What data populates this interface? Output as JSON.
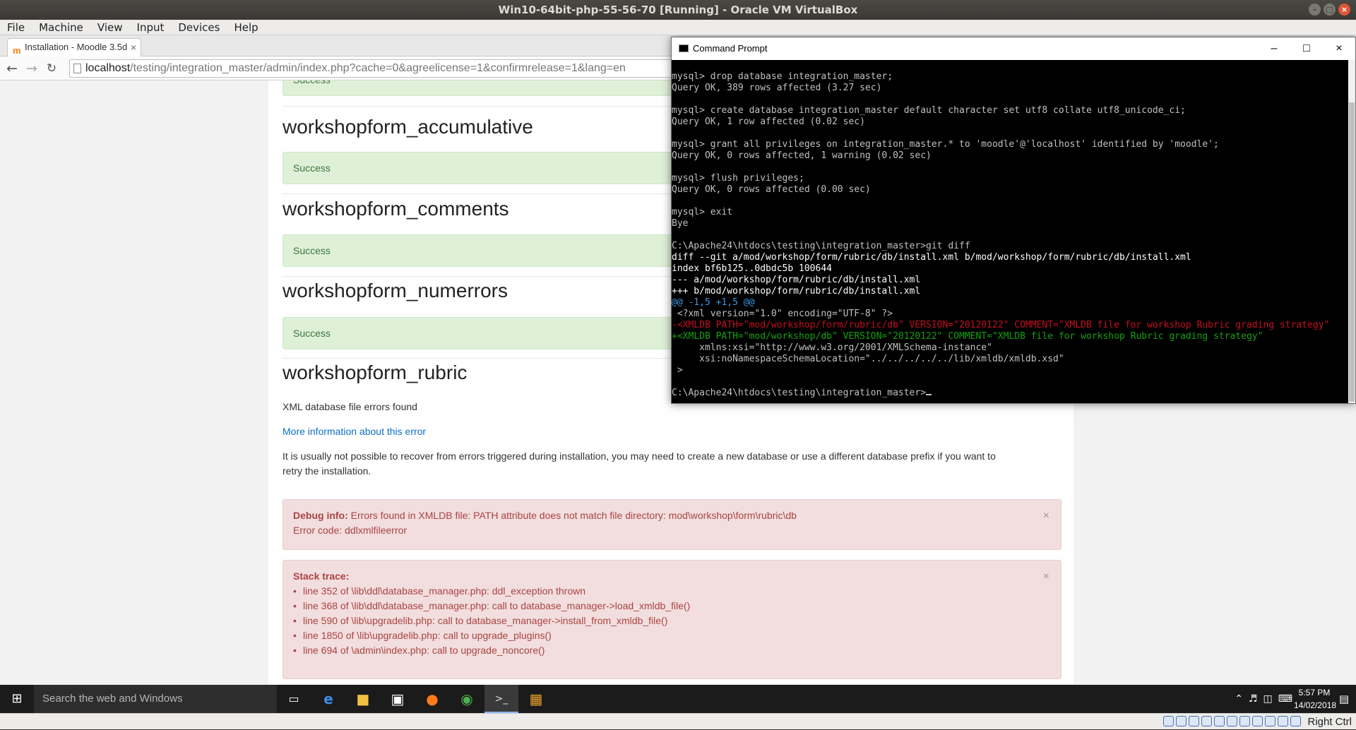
{
  "host": {
    "window_title": "Win10-64bit-php-55-56-70 [Running] - Oracle VM VirtualBox",
    "menu": [
      "File",
      "Machine",
      "View",
      "Input",
      "Devices",
      "Help"
    ],
    "host_key": "Right Ctrl"
  },
  "browser": {
    "tab_title": "Installation - Moodle 3.5d",
    "url_host": "localhost",
    "url_path": "/testing/integration_master/admin/index.php?cache=0&agreelicense=1&confirmrelease=1&lang=en"
  },
  "moodle": {
    "top_success": "Success",
    "sections": [
      {
        "title": "workshopform_accumulative",
        "status": "Success"
      },
      {
        "title": "workshopform_comments",
        "status": "Success"
      },
      {
        "title": "workshopform_numerrors",
        "status": "Success"
      }
    ],
    "error_section_title": "workshopform_rubric",
    "error_summary": "XML database file errors found",
    "more_info_link": "More information about this error",
    "recover_text_1": "It is usually not possible to recover from errors triggered during installation, you may need to create a new database or use a different database prefix if you want to",
    "recover_text_2": "retry the installation.",
    "debug_label": "Debug info:",
    "debug_message": "Errors found in XMLDB file: PATH attribute does not match file directory: mod\\workshop\\form\\rubric\\db",
    "error_code": "Error code: ddlxmlfileerror",
    "stack_label": "Stack trace:",
    "stack_trace": [
      "line 352 of \\lib\\ddl\\database_manager.php: ddl_exception thrown",
      "line 368 of \\lib\\ddl\\database_manager.php: call to database_manager->load_xmldb_file()",
      "line 590 of \\lib\\upgradelib.php: call to database_manager->install_from_xmldb_file()",
      "line 1850 of \\lib\\upgradelib.php: call to upgrade_plugins()",
      "line 694 of \\admin\\index.php: call to upgrade_noncore()"
    ]
  },
  "cmd": {
    "title": "Command Prompt",
    "lines": [
      {
        "t": "mysql> drop database integration_master;",
        "c": ""
      },
      {
        "t": "Query OK, 389 rows affected (3.27 sec)",
        "c": ""
      },
      {
        "t": "",
        "c": ""
      },
      {
        "t": "mysql> create database integration_master default character set utf8 collate utf8_unicode_ci;",
        "c": ""
      },
      {
        "t": "Query OK, 1 row affected (0.02 sec)",
        "c": ""
      },
      {
        "t": "",
        "c": ""
      },
      {
        "t": "mysql> grant all privileges on integration_master.* to 'moodle'@'localhost' identified by 'moodle';",
        "c": ""
      },
      {
        "t": "Query OK, 0 rows affected, 1 warning (0.02 sec)",
        "c": ""
      },
      {
        "t": "",
        "c": ""
      },
      {
        "t": "mysql> flush privileges;",
        "c": ""
      },
      {
        "t": "Query OK, 0 rows affected (0.00 sec)",
        "c": ""
      },
      {
        "t": "",
        "c": ""
      },
      {
        "t": "mysql> exit",
        "c": ""
      },
      {
        "t": "Bye",
        "c": ""
      },
      {
        "t": "",
        "c": ""
      },
      {
        "t": "C:\\Apache24\\htdocs\\testing\\integration_master>git diff",
        "c": ""
      },
      {
        "t": "diff --git a/mod/workshop/form/rubric/db/install.xml b/mod/workshop/form/rubric/db/install.xml",
        "c": "w"
      },
      {
        "t": "index bf6b125..0dbdc5b 100644",
        "c": "w"
      },
      {
        "t": "--- a/mod/workshop/form/rubric/db/install.xml",
        "c": "w"
      },
      {
        "t": "+++ b/mod/workshop/form/rubric/db/install.xml",
        "c": "w"
      },
      {
        "t": "@@ -1,5 +1,5 @@",
        "c": "cy"
      },
      {
        "t": " <?xml version=\"1.0\" encoding=\"UTF-8\" ?>",
        "c": ""
      },
      {
        "t": "-<XMLDB PATH=\"mod/workshop/form/rubric/db\" VERSION=\"20120122\" COMMENT=\"XMLDB file for workshop Rubric grading strategy\"",
        "c": "rd"
      },
      {
        "t": "+<XMLDB PATH=\"mod/workshop/db\" VERSION=\"20120122\" COMMENT=\"XMLDB file for workshop Rubric grading strategy\"",
        "c": "gr"
      },
      {
        "t": "     xmlns:xsi=\"http://www.w3.org/2001/XMLSchema-instance\"",
        "c": ""
      },
      {
        "t": "     xsi:noNamespaceSchemaLocation=\"../../../../../lib/xmldb/xmldb.xsd\"",
        "c": ""
      },
      {
        "t": " >",
        "c": ""
      },
      {
        "t": "",
        "c": ""
      },
      {
        "t": "C:\\Apache24\\htdocs\\testing\\integration_master>",
        "c": "",
        "cursor": true
      }
    ]
  },
  "taskbar": {
    "search_placeholder": "Search the web and Windows",
    "clock_time": "5:57 PM",
    "clock_date": "14/02/2018"
  }
}
